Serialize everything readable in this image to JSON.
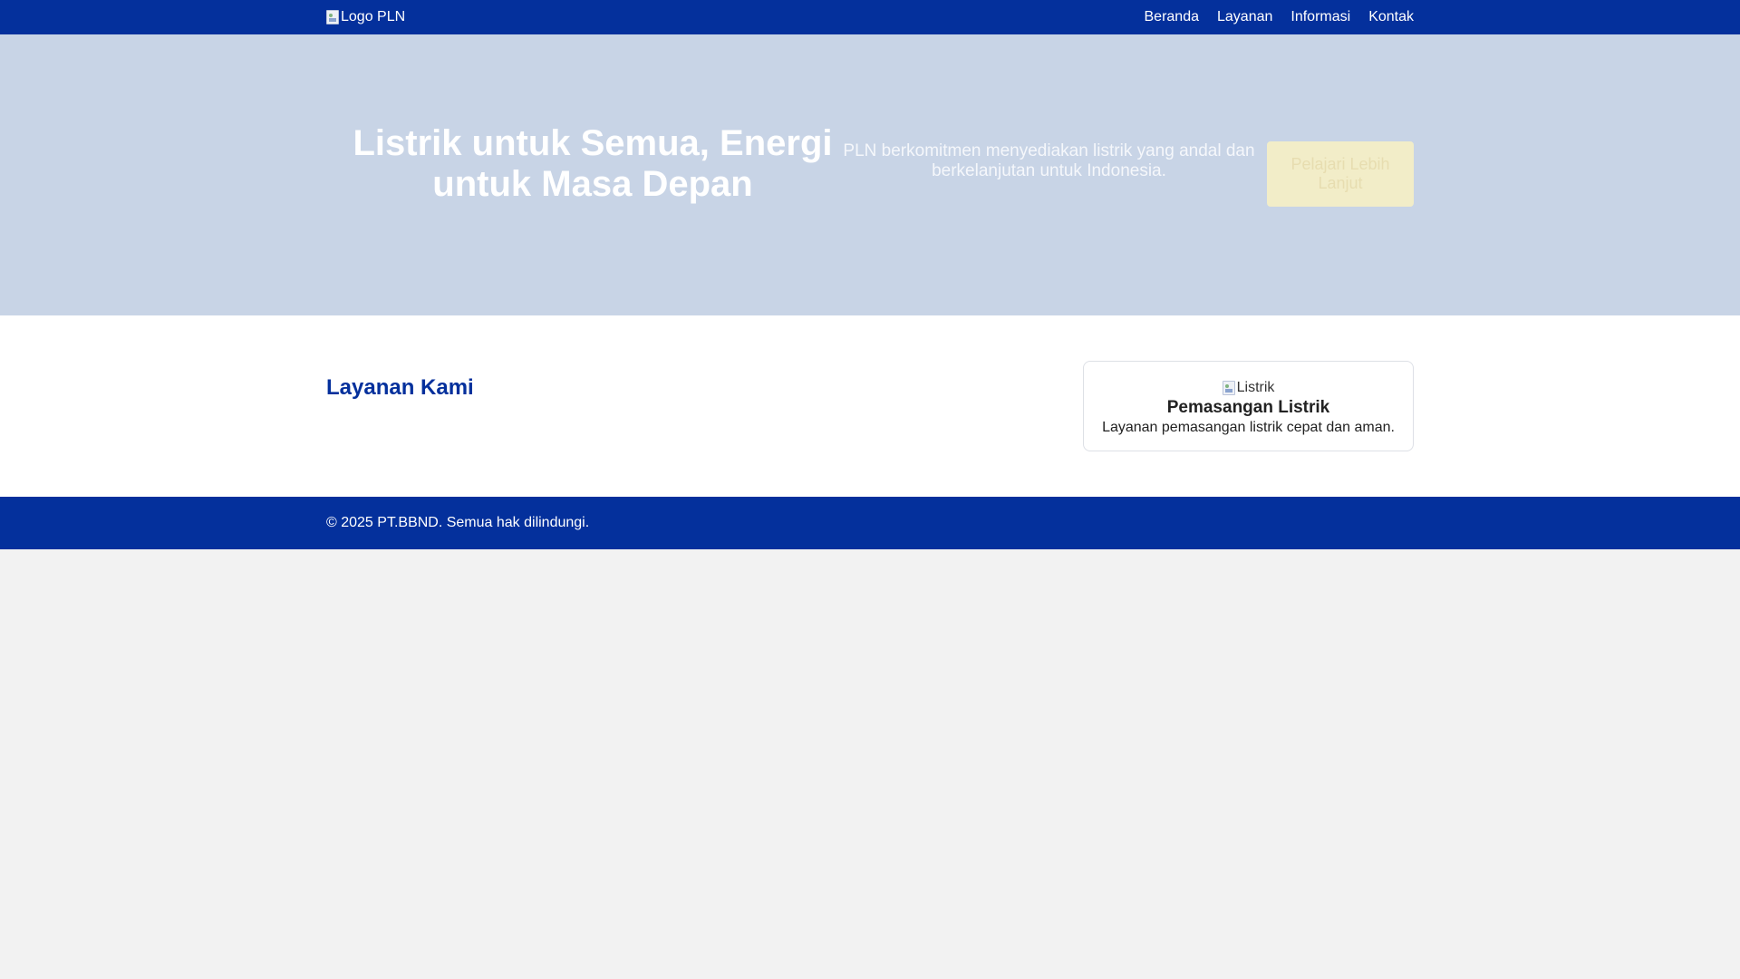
{
  "header": {
    "logo_alt": "Logo PLN",
    "nav": [
      {
        "label": "Beranda"
      },
      {
        "label": "Layanan"
      },
      {
        "label": "Informasi"
      },
      {
        "label": "Kontak"
      }
    ]
  },
  "hero": {
    "title": "Listrik untuk Semua, Energi untuk Masa Depan",
    "description": "PLN berkomitmen menyediakan listrik yang andal dan berkelanjutan untuk Indonesia.",
    "button_label": "Pelajari Lebih Lanjut"
  },
  "services": {
    "title": "Layanan Kami",
    "cards": [
      {
        "image_alt": "Listrik",
        "title": "Pemasangan Listrik",
        "description": "Layanan pemasangan listrik cepat dan aman."
      }
    ]
  },
  "footer": {
    "copyright": "© 2025 PT.BBND. Semua hak dilindungi."
  },
  "colors": {
    "primary": "#04309c",
    "hero_bg": "#c8d4e6",
    "button_bg": "#f2edc8"
  }
}
